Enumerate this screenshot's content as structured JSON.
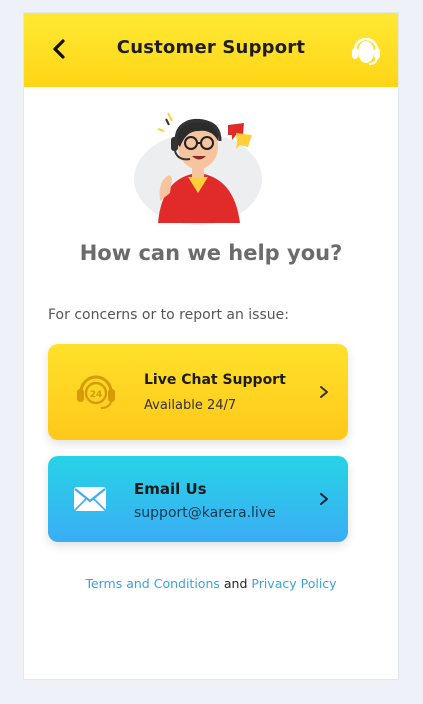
{
  "header": {
    "title": "Customer Support",
    "back_icon": "chevron-left-icon",
    "support_icon": "headset-icon"
  },
  "main": {
    "help_title": "How can we help you?",
    "concern_text": "For concerns or to report an issue:"
  },
  "cards": [
    {
      "title": "Live Chat Support",
      "subtitle": "Available 24/7",
      "icon": "headset-24-icon"
    },
    {
      "title": "Email Us",
      "subtitle": "support@karera.live",
      "icon": "envelope-icon"
    }
  ],
  "footer": {
    "terms_label": "Terms and Conditions",
    "and_text": "and",
    "privacy_label": "Privacy Policy"
  },
  "colors": {
    "header_yellow": "#ffd516",
    "chat_card": "#ffc81a",
    "email_card": "#3aadf4",
    "link": "#3aa2e0"
  }
}
